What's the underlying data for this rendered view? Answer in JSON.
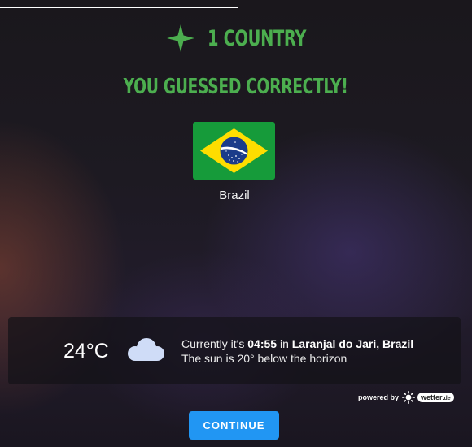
{
  "progress": {
    "fraction": 0.505
  },
  "result": {
    "count_label": "1 COUNTRY",
    "heading": "YOU GUESSED CORRECTLY!",
    "accent_color": "#4cae4f"
  },
  "country": {
    "name": "Brazil",
    "flag_icon": "brazil-flag-icon"
  },
  "weather": {
    "temperature": "24°C",
    "condition_icon": "cloud-icon",
    "line1_prefix": "Currently it's ",
    "time": "04:55",
    "line1_mid": " in ",
    "location": "Laranjal do Jari, Brazil",
    "line2": "The sun is 20° below the horizon"
  },
  "attribution": {
    "powered_by": "powered by",
    "provider": "wetter",
    "provider_suffix": ".de"
  },
  "actions": {
    "continue_label": "CONTINUE",
    "continue_color": "#2196f3"
  }
}
